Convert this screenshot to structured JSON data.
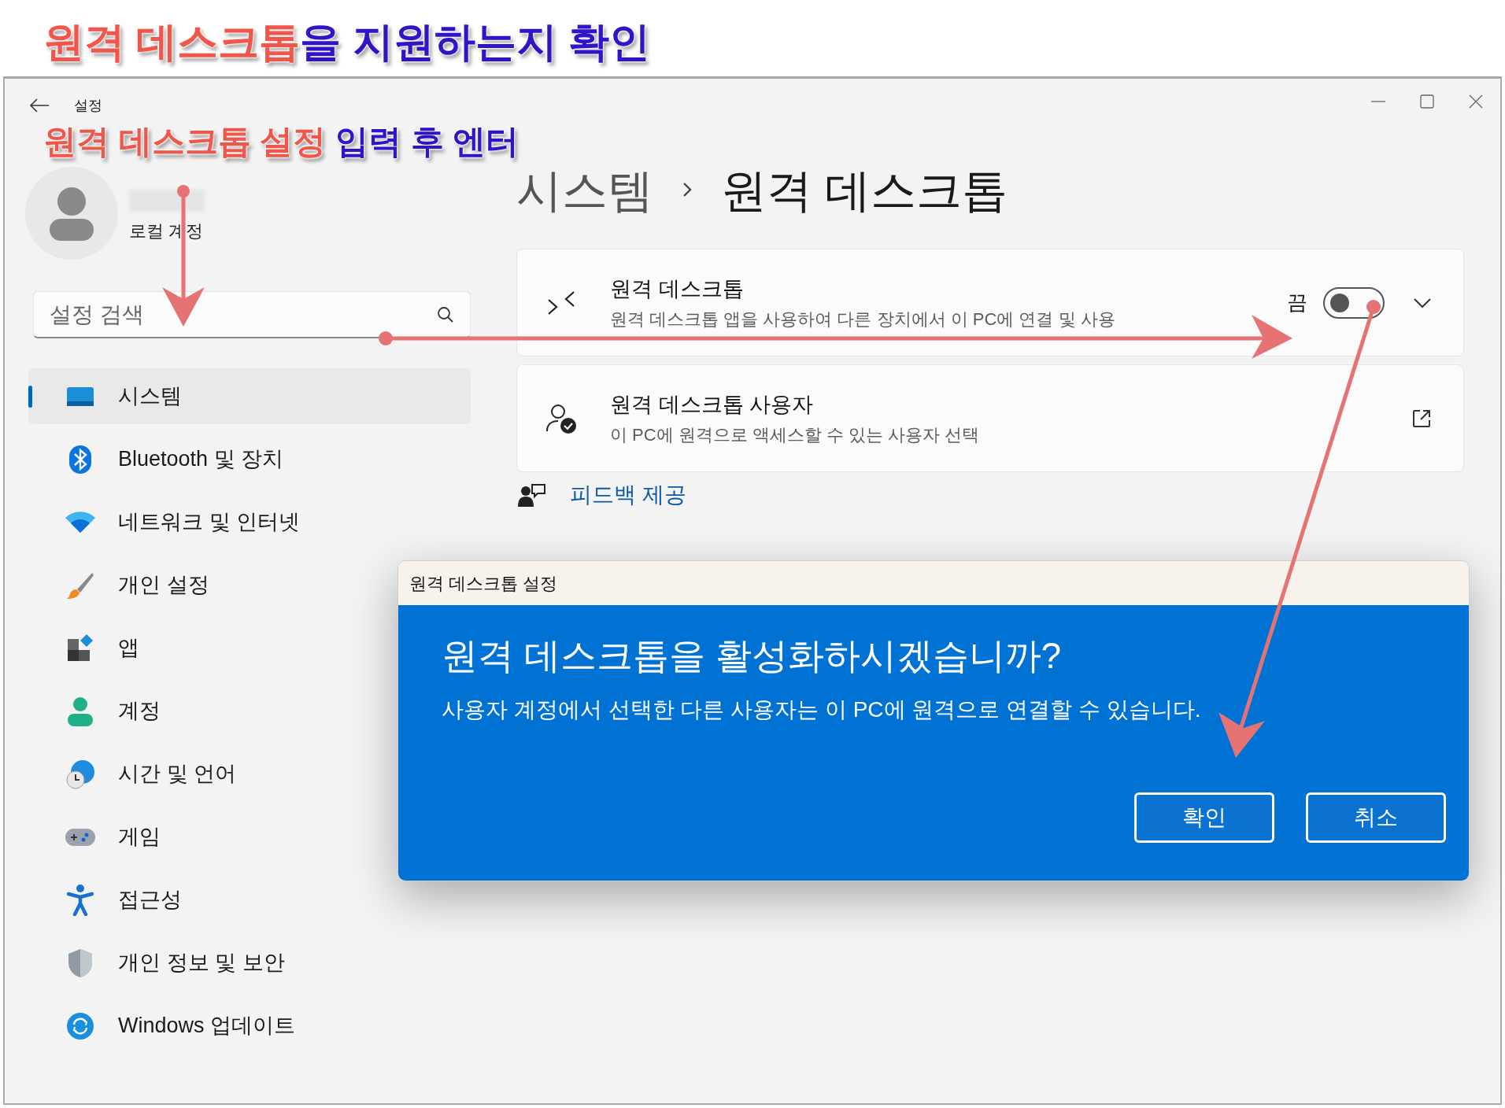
{
  "annotations": [
    {
      "segments": [
        {
          "text": "원격 데스크톱",
          "emphasis": true
        },
        {
          "text": "을 지원하는지 확인",
          "emphasis": false
        }
      ]
    },
    {
      "segments": [
        {
          "text": "원격 데스크톱 설정",
          "emphasis": true
        },
        {
          "text": " 입력 후 엔터",
          "emphasis": false
        }
      ]
    }
  ],
  "window": {
    "title": "설정"
  },
  "account": {
    "type": "로컬 계정"
  },
  "search": {
    "placeholder": "설정 검색"
  },
  "nav": [
    {
      "label": "시스템",
      "selected": true
    },
    {
      "label": "Bluetooth 및 장치",
      "selected": false
    },
    {
      "label": "네트워크 및 인터넷",
      "selected": false
    },
    {
      "label": "개인 설정",
      "selected": false
    },
    {
      "label": "앱",
      "selected": false
    },
    {
      "label": "계정",
      "selected": false
    },
    {
      "label": "시간 및 언어",
      "selected": false
    },
    {
      "label": "게임",
      "selected": false
    },
    {
      "label": "접근성",
      "selected": false
    },
    {
      "label": "개인 정보 및 보안",
      "selected": false
    },
    {
      "label": "Windows 업데이트",
      "selected": false
    }
  ],
  "breadcrumb": [
    "시스템",
    "원격 데스크톱"
  ],
  "cards": [
    {
      "kind": "toggle",
      "title": "원격 데스크톱",
      "description": "원격 데스크톱 앱을 사용하여 다른 장치에서 이 PC에 연결 및 사용",
      "state_label": "끔",
      "on": false,
      "expanded": false
    },
    {
      "kind": "link",
      "title": "원격 데스크톱 사용자",
      "description": "이 PC에 원격으로 액세스할 수 있는 사용자 선택"
    }
  ],
  "feedback": {
    "label": "피드백 제공"
  },
  "dialog": {
    "title": "원격 데스크톱 설정",
    "heading": "원격 데스크톱을 활성화하시겠습니까?",
    "message": "사용자 계정에서 선택한 다른 사용자는 이 PC에 원격으로 연결할 수 있습니다.",
    "buttons": [
      "확인",
      "취소"
    ]
  }
}
